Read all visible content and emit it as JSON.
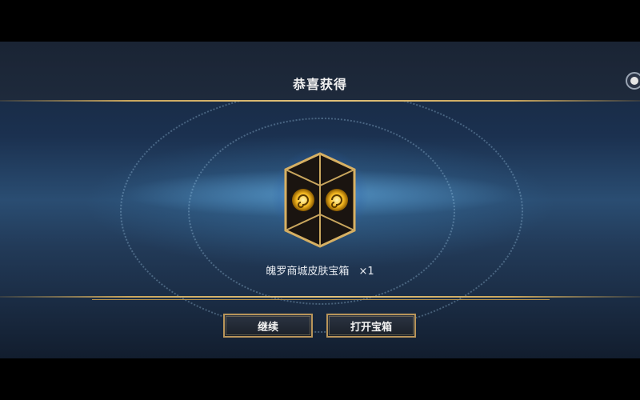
{
  "header": {
    "title": "恭喜获得"
  },
  "reward": {
    "name": "魄罗商城皮肤宝箱",
    "quantity": "×1"
  },
  "buttons": {
    "continue_label": "继续",
    "open_label": "打开宝箱"
  },
  "icons": {
    "chest": "treasure-chest-icon",
    "corner": "settings-dot-icon"
  },
  "colors": {
    "gold": "#c9a65e",
    "background": "#1b3150",
    "glow": "#50aaff"
  }
}
